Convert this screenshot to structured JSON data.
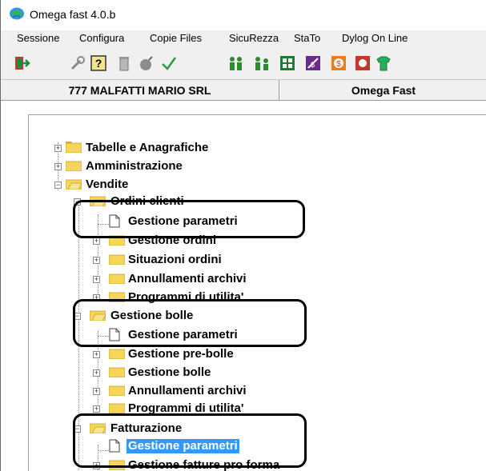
{
  "window": {
    "title": "Omega fast  4.0.b"
  },
  "menubar": {
    "items": [
      {
        "id": "sessione",
        "label": "Sessione"
      },
      {
        "id": "configura",
        "label": "Configura"
      },
      {
        "id": "copie",
        "label": "Copie Files"
      },
      {
        "id": "sicurezza",
        "label": "SicuRezza"
      },
      {
        "id": "stato",
        "label": "StaTo"
      },
      {
        "id": "dylog",
        "label": "Dylog On Line"
      }
    ]
  },
  "toolbar": {
    "icons": [
      "exit-icon",
      "tools-icon",
      "help-icon",
      "trash-icon",
      "bomb-icon",
      "check-icon",
      "users-icon",
      "user-group-icon",
      "calculator-icon",
      "edit-money-icon",
      "dollar-icon",
      "stamp-icon",
      "tshirt-icon"
    ]
  },
  "infobar": {
    "company": "777 MALFATTI MARIO SRL",
    "product": "Omega Fast"
  },
  "tree": {
    "tabelle": "Tabelle e Anagrafiche",
    "amministrazione": "Amministrazione",
    "vendite": "Vendite",
    "ordini_clienti": "Ordini clienti",
    "oc_gestione_parametri": "Gestione parametri",
    "gestione_ordini": "Gestione ordini",
    "situazioni_ordini": "Situazioni ordini",
    "oc_annullamenti": "Annullamenti archivi",
    "oc_programmi": "Programmi di utilita'",
    "gestione_bolle_folder": "Gestione bolle",
    "gb_gestione_parametri": "Gestione parametri",
    "gestione_pre_bolle": "Gestione pre-bolle",
    "gestione_bolle": "Gestione bolle",
    "gb_annullamenti": "Annullamenti archivi",
    "gb_programmi": "Programmi di utilita'",
    "fatturazione": "Fatturazione",
    "ft_gestione_parametri": "Gestione parametri",
    "gestione_fatture": "Gestione fatture pro forma"
  },
  "colors": {
    "selection": "#3399ff",
    "folder": "#f5d55a",
    "callout": "#000000"
  }
}
